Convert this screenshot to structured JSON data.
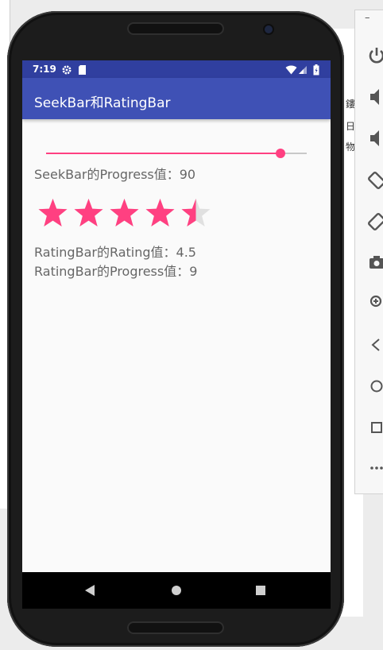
{
  "statusbar": {
    "time": "7:19",
    "icons": [
      "settings-icon",
      "sd-card-icon",
      "wifi-icon",
      "signal-icon",
      "battery-icon"
    ]
  },
  "appbar": {
    "title": "SeekBar和RatingBar"
  },
  "seekbar": {
    "progress": 90,
    "max": 100,
    "color": "#ff4081"
  },
  "seekbar_text": "SeekBar的Progress值：90",
  "ratingbar": {
    "rating": 4.5,
    "num_stars": 5,
    "color": "#ff4081",
    "empty_color": "#e0e0e0"
  },
  "rating_text": "RatingBar的Rating值：4.5",
  "rating_progress_text": "RatingBar的Progress值：9",
  "navbar": {
    "buttons": [
      "back-icon",
      "home-icon",
      "recents-icon"
    ]
  },
  "emulator_toolbar": {
    "minimize_label": "–",
    "buttons": [
      "power-icon",
      "volume-up-icon",
      "volume-down-icon",
      "rotate-left-icon",
      "rotate-right-icon",
      "camera-icon",
      "zoom-icon",
      "back-icon",
      "home-icon",
      "overview-icon",
      "more-icon"
    ]
  },
  "background_window": {
    "side_chars": [
      "鏤",
      "日",
      "物"
    ]
  },
  "colors": {
    "statusbar": "#303f9f",
    "appbar": "#3f51b5",
    "accent": "#ff4081"
  }
}
